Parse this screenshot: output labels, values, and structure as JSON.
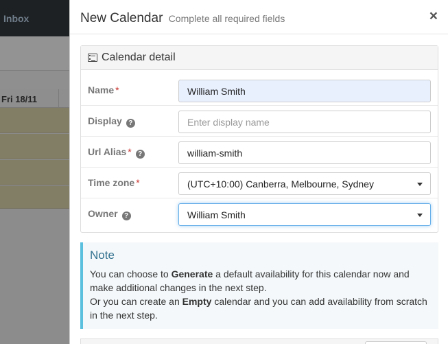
{
  "background": {
    "inbox_label": "Inbox",
    "day_header": "Fri 18/11"
  },
  "modal": {
    "title": "New Calendar",
    "subtitle": "Complete all required fields",
    "close_glyph": "×"
  },
  "panel": {
    "heading": "Calendar detail"
  },
  "form": {
    "name": {
      "label": "Name",
      "required": "*",
      "value": "William Smith"
    },
    "display": {
      "label": "Display",
      "help": "?",
      "value": "",
      "placeholder": "Enter display name"
    },
    "url_alias": {
      "label": "Url Alias",
      "required": "*",
      "help": "?",
      "value": "william-smith"
    },
    "time_zone": {
      "label": "Time zone",
      "required": "*",
      "value": "(UTC+10:00) Canberra, Melbourne, Sydney"
    },
    "owner": {
      "label": "Owner",
      "help": "?",
      "value": "William Smith"
    }
  },
  "note": {
    "title": "Note",
    "p1_pre": "You can choose to ",
    "p1_bold": "Generate",
    "p1_post": " a default availability for this calendar now and make additional changes in the next step.",
    "p2_pre": "Or you can create an ",
    "p2_bold": "Empty",
    "p2_post": " calendar and you can add availability from scratch in the next step."
  },
  "colors": {
    "accent": "#5bc0de",
    "required": "#c9302c",
    "focus": "#66afe9"
  }
}
